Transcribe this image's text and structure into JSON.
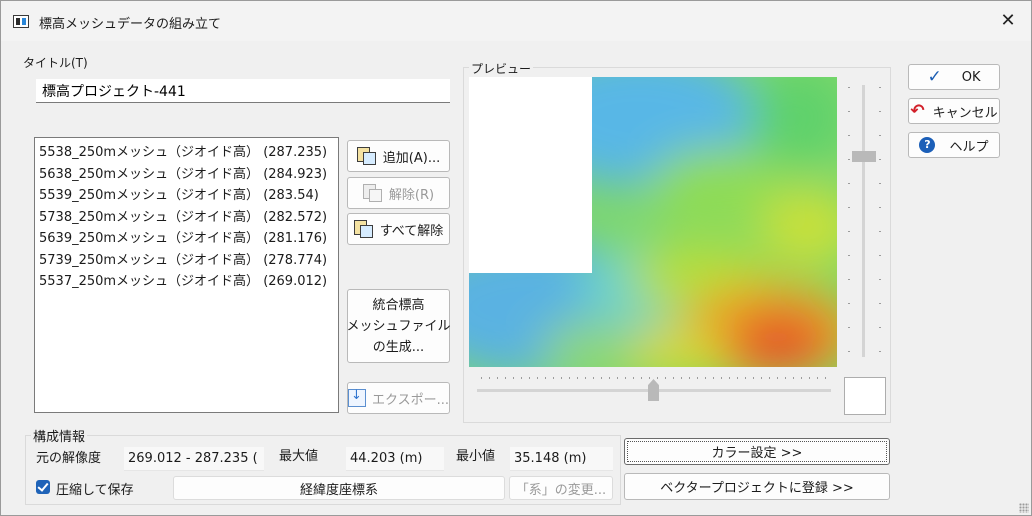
{
  "window": {
    "title": "標高メッシュデータの組み立て",
    "close_glyph": "✕"
  },
  "title_section": {
    "label": "タイトル(T)",
    "value": "標高プロジェクト-441"
  },
  "mesh_list": [
    "5538_250mメッシュ（ジオイド高） (287.235)",
    "5638_250mメッシュ（ジオイド高） (284.923)",
    "5539_250mメッシュ（ジオイド高） (283.54)",
    "5738_250mメッシュ（ジオイド高） (282.572)",
    "5639_250mメッシュ（ジオイド高） (281.176)",
    "5739_250mメッシュ（ジオイド高） (278.774)",
    "5537_250mメッシュ（ジオイド高） (269.012)"
  ],
  "buttons": {
    "add": "追加(A)...",
    "remove": "解除(R)",
    "remove_all": "すべて解除",
    "generate_line1": "統合標高",
    "generate_line2": "メッシュファイル",
    "generate_line3": "の生成...",
    "export": "エクスポー...",
    "ok": "OK",
    "cancel": "キャンセル",
    "help": "ヘルプ",
    "color_settings": "カラー設定 >>",
    "register_vector": "ベクタープロジェクトに登録 >>",
    "change_system": "「系」の変更..."
  },
  "preview": {
    "label": "プレビュー"
  },
  "info": {
    "caption": "構成情報",
    "resolution_label": "元の解像度",
    "resolution_value": "269.012 - 287.235 (",
    "max_label": "最大値",
    "max_value": "44.203 (m)",
    "min_label": "最小値",
    "min_value": "35.148 (m)",
    "compress_label": "圧縮して保存",
    "compress_checked": true,
    "coord_system": "経緯度座標系"
  },
  "icons": {
    "ok": "checkmark-icon",
    "cancel": "undo-arrow-icon",
    "help": "question-icon"
  },
  "colors": {
    "accent": "#1f63b8",
    "cancel_red": "#d2202a"
  }
}
